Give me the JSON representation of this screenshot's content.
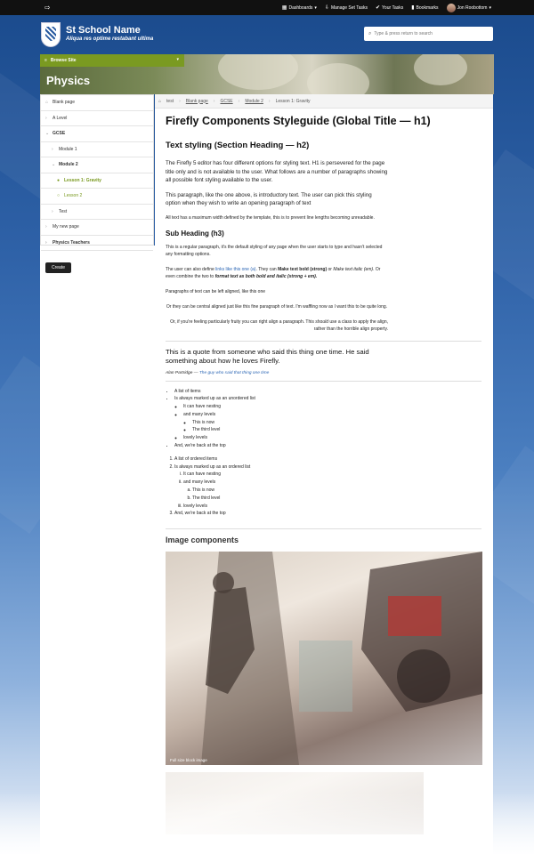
{
  "topbar": {
    "items": [
      {
        "icon": "grid-icon",
        "glyph": "▦",
        "label": "Dashboards",
        "caret": "▾"
      },
      {
        "icon": "download-icon",
        "glyph": "⇩",
        "label": "Manage Set Tasks",
        "caret": ""
      },
      {
        "icon": "check-icon",
        "glyph": "✔",
        "label": "Your Tasks",
        "caret": ""
      },
      {
        "icon": "bookmark-icon",
        "glyph": "▮",
        "label": "Bookmarks",
        "caret": ""
      },
      {
        "icon": "avatar",
        "glyph": "",
        "label": "Jon Roobottom",
        "caret": "▾"
      }
    ]
  },
  "header": {
    "school_name": "St School Name",
    "motto": "Aliqua res optime restabant ultima",
    "search_placeholder": "Type & press return to search"
  },
  "banner": {
    "browse_label": "Browse Site",
    "title": "Physics"
  },
  "sidebar": {
    "items": [
      {
        "label": "Blank page",
        "marker": "⌂",
        "bold": false,
        "level": 0,
        "lesson": false
      },
      {
        "label": "A Level",
        "marker": "›",
        "bold": false,
        "level": 0,
        "lesson": false
      },
      {
        "label": "GCSE",
        "marker": "⌄",
        "bold": true,
        "level": 0,
        "lesson": false
      },
      {
        "label": "Module 1",
        "marker": "›",
        "bold": false,
        "level": 1,
        "lesson": false
      },
      {
        "label": "Module 2",
        "marker": "⌄",
        "bold": true,
        "level": 1,
        "lesson": false
      },
      {
        "label": "Lesson 1: Gravity",
        "marker": "●",
        "bold": true,
        "level": 2,
        "lesson": true
      },
      {
        "label": "Lesson 2",
        "marker": "○",
        "bold": false,
        "level": 2,
        "lesson": true
      },
      {
        "label": "Test",
        "marker": "›",
        "bold": false,
        "level": 1,
        "lesson": false
      },
      {
        "label": "My new page",
        "marker": "›",
        "bold": false,
        "level": 0,
        "lesson": false
      },
      {
        "label": "Physics Teachers",
        "marker": "›",
        "bold": true,
        "level": 0,
        "lesson": false
      }
    ],
    "create_label": "Create"
  },
  "breadcrumb": [
    "test",
    "Blank page",
    "GCSE",
    "Module 2",
    "Lesson 1: Gravity"
  ],
  "content": {
    "h1": "Firefly Components Styleguide (Global Title — h1)",
    "h2": "Text styling (Section Heading — h2)",
    "intro1": "The Firefly 5 editor has four different options for styling text. H1 is persevered for the page title only and is not available to the user. What follows are a number of paragraphs showing all possible font styling available to the user.",
    "intro2": "This paragraph, like the one above, is introductory text. The user can pick this styling option when they wish to write an opening paragraph of text",
    "small1": "All text has a maximum width defined by the template, this is to prevent line lengths becoming unreadable.",
    "h3": "Sub Heading (h3)",
    "p1": "This is a regular paragraph, it's the default styling of any page when the user starts to type and hasn't selected any formatting options.",
    "p2_a": "The user can also define ",
    "p2_link": "links like this one (a)",
    "p2_b": ". They can ",
    "p2_bold": "Make text bold (strong)",
    "p2_c": " or ",
    "p2_italic": "Make text italic (em)",
    "p2_d": ". Or even combine the two to ",
    "p2_bi": "format text as both bold and italic (strong + em).",
    "p3": "Paragraphs of text can be left aligned, like this one",
    "p4": "Or they can be central aligned just like this fine paragraph of text. I'm waffling now as I want this to be quite long.",
    "p5_a": "Or, if you're feeling particularly fruity you can right align a paragraph. This ",
    "p5_em": "should",
    "p5_b": " use a class to apply the align, rather than the horrible align property.",
    "quote": "This is a quote from someone who said this thing one time. He said something about how he loves Firefly.",
    "quote_author": "Alan Partridge",
    "quote_dash": " — ",
    "quote_source": "The guy who said that thing one time",
    "ul": {
      "i1": "A list of items",
      "i2": "Is always marked up as an unordered list",
      "i2a": "It can have nesting",
      "i2b": "and many levels",
      "i2b1": "This is now",
      "i2b2": "The third level",
      "i2c": "lovely levels",
      "i3": "And, we're back at the top"
    },
    "ol": {
      "i1": "A list of ordered items",
      "i2": "Is always marked up as an ordered list",
      "i2a": "It can have nesting",
      "i2b": "and many levels",
      "i2b1": "This is now",
      "i2b2": "The third level",
      "i2c": "lovely levels",
      "i3": "And, we're back at the top"
    },
    "image_heading": "Image components",
    "image_caption": "Full size block image"
  }
}
